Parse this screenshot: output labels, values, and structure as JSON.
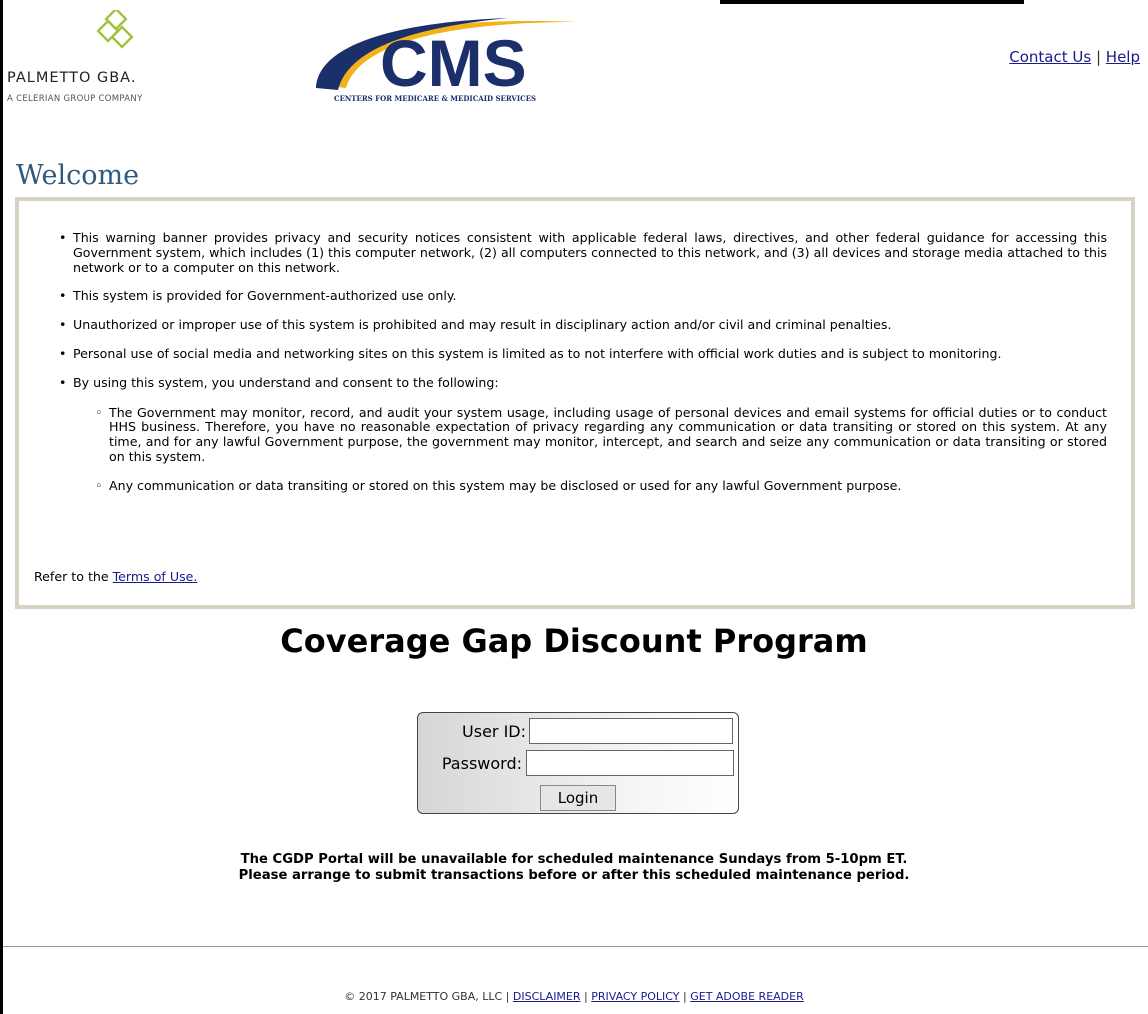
{
  "header": {
    "palmetto_name": "PALMETTO GBA.",
    "palmetto_tagline": "A CELERIAN GROUP COMPANY",
    "cms_logo_text": "CMS",
    "cms_tagline": "CENTERS FOR MEDICARE & MEDICAID SERVICES",
    "contact_link": "Contact Us",
    "link_separator": "|",
    "help_link": "Help"
  },
  "welcome_heading": "Welcome",
  "banner": {
    "items": [
      "This warning banner provides privacy and security notices consistent with applicable federal laws, directives, and other federal guidance for accessing this Government system, which includes (1) this computer network, (2) all computers connected to this network, and (3) all devices and storage media attached to this network or to a computer on this network.",
      "This system is provided for Government-authorized use only.",
      "Unauthorized or improper use of this system is prohibited and may result in disciplinary action and/or civil and criminal penalties.",
      "Personal use of social media and networking sites on this system is limited as to not interfere with official work duties and is subject to monitoring.",
      "By using this system, you understand and consent to the following:"
    ],
    "sub_items": [
      "The Government may monitor, record, and audit your system usage, including usage of personal devices and email systems for official duties or to conduct HHS business. Therefore, you have no reasonable expectation of privacy regarding any communication or data transiting or stored on this system. At any time, and for any lawful Government purpose, the government may monitor, intercept, and search and seize any communication or data transiting or stored on this system.",
      "Any communication or data transiting or stored on this system may be disclosed or used for any lawful Government purpose."
    ],
    "terms_prefix": "Refer to the ",
    "terms_link": "Terms of Use."
  },
  "program_title": "Coverage Gap Discount Program",
  "login": {
    "user_id_label": "User ID:",
    "user_id_value": "",
    "password_label": "Password:",
    "password_value": "",
    "login_button": "Login"
  },
  "notice": {
    "line1": "The CGDP Portal will be unavailable for scheduled maintenance Sundays from 5-10pm ET.",
    "line2": "Please arrange to submit transactions before or after this scheduled maintenance period."
  },
  "footer": {
    "copyright": "© 2017 PALMETTO GBA, LLC",
    "sep": "|",
    "disclaimer": "DISCLAIMER",
    "privacy": "PRIVACY POLICY",
    "adobe": "GET ADOBE READER"
  },
  "colors": {
    "welcome": "#2e5a80",
    "banner_border": "#d7d2c2",
    "palmetto_green": "#9ec23e",
    "cms_blue": "#1b2f6a",
    "cms_gold": "#f2b21b"
  }
}
